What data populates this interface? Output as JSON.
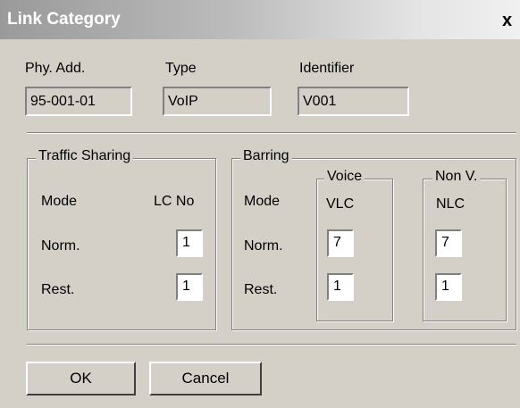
{
  "window": {
    "title": "Link Category",
    "close_glyph": "x"
  },
  "header": {
    "phy_add_label": "Phy. Add.",
    "phy_add_value": "95-001-01",
    "type_label": "Type",
    "type_value": "VoIP",
    "identifier_label": "Identifier",
    "identifier_value": "V001"
  },
  "traffic_sharing": {
    "title": "Traffic Sharing",
    "mode_label": "Mode",
    "lc_no_label": "LC No",
    "norm_label": "Norm.",
    "rest_label": "Rest.",
    "norm_value": "1",
    "rest_value": "1"
  },
  "barring": {
    "title": "Barring",
    "mode_label": "Mode",
    "norm_label": "Norm.",
    "rest_label": "Rest.",
    "voice": {
      "title": "Voice",
      "col_label": "VLC",
      "norm_value": "7",
      "rest_value": "1"
    },
    "non_voice": {
      "title": "Non V.",
      "col_label": "NLC",
      "norm_value": "7",
      "rest_value": "1"
    }
  },
  "buttons": {
    "ok": "OK",
    "cancel": "Cancel"
  }
}
